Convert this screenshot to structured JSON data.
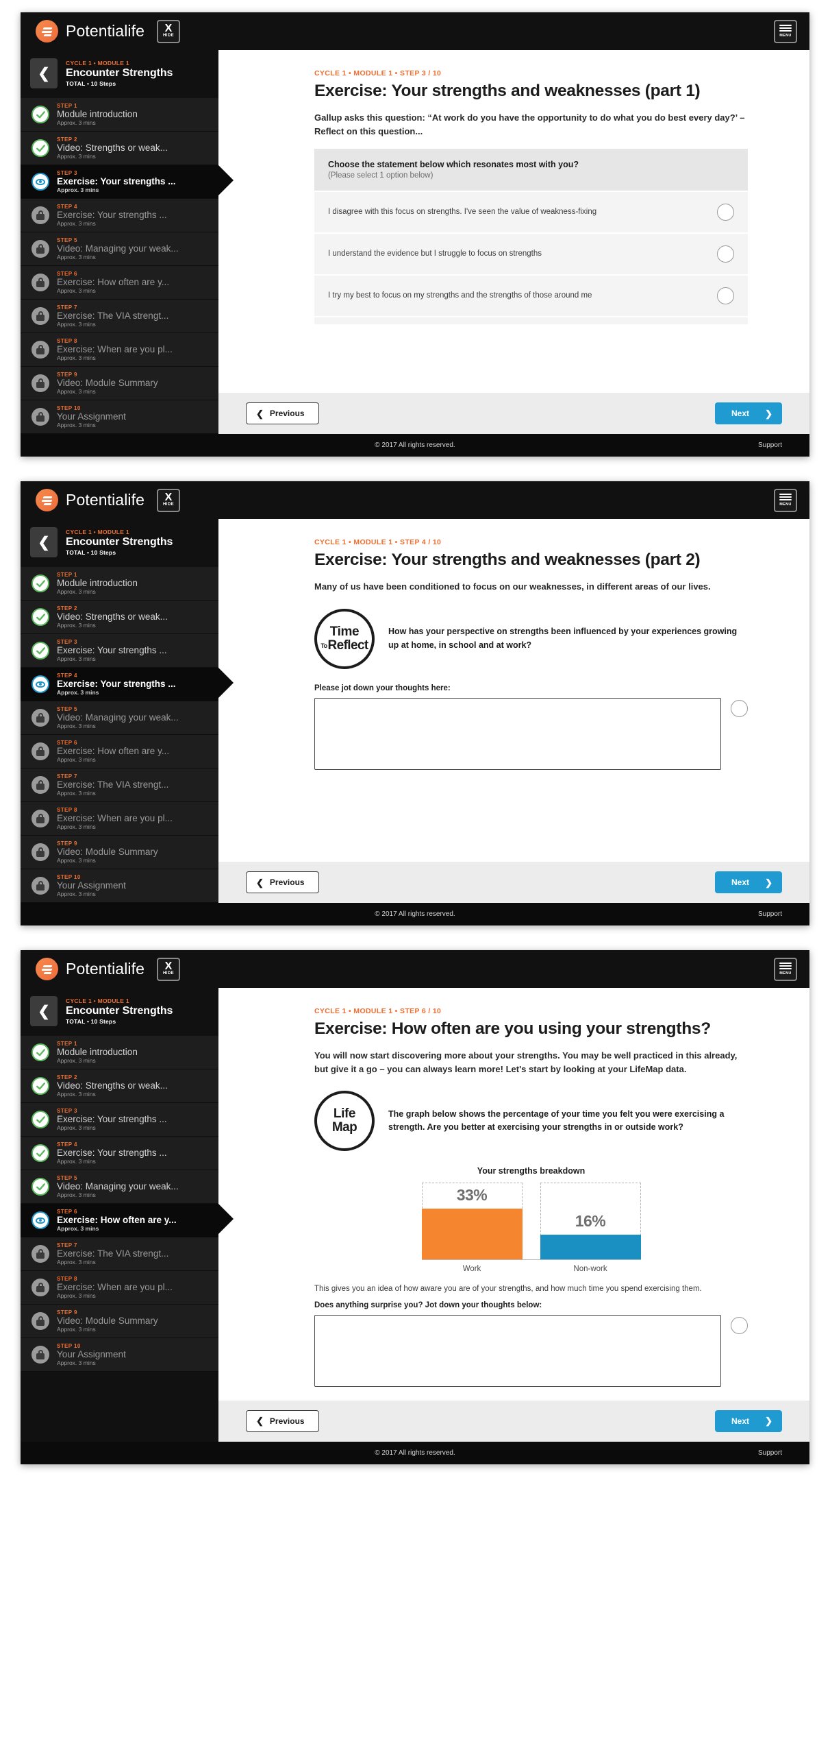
{
  "brand": {
    "name": "Potentialife",
    "logo_icon": "potentialife-logo-icon"
  },
  "topbar": {
    "hide_label": "HIDE",
    "hide_x": "X",
    "menu_label": "MENU"
  },
  "sidebar": {
    "back_icon": "chevron-left-icon",
    "module_crumb": "CYCLE 1 • MODULE 1",
    "module_title": "Encounter Strengths",
    "module_total": "TOTAL • 10 Steps",
    "time_default": "Approx. 3 mins",
    "steps": [
      {
        "no": "STEP 1",
        "name": "Module introduction",
        "time": "Approx. 3 mins",
        "state": "done",
        "icon": "check-circle-icon"
      },
      {
        "no": "STEP 2",
        "name": "Video: Strengths or weak...",
        "time": "Approx. 3 mins",
        "state": "done",
        "icon": "check-circle-icon"
      },
      {
        "no": "STEP 3",
        "name": "Exercise: Your strengths ...",
        "time": "Approx. 3 mins",
        "state": "done",
        "icon": "check-circle-icon"
      },
      {
        "no": "STEP 4",
        "name": "Exercise: Your strengths ...",
        "time": "Approx. 3 mins",
        "state": "done",
        "icon": "check-circle-icon"
      },
      {
        "no": "STEP 5",
        "name": "Video: Managing your weak...",
        "time": "Approx. 3 mins",
        "state": "done",
        "icon": "check-circle-icon"
      },
      {
        "no": "STEP 6",
        "name": "Exercise: How often are y...",
        "time": "Approx. 3 mins",
        "state": "locked",
        "icon": "lock-icon"
      },
      {
        "no": "STEP 7",
        "name": "Exercise: The VIA strengt...",
        "time": "Approx. 3 mins",
        "state": "locked",
        "icon": "lock-icon"
      },
      {
        "no": "STEP 8",
        "name": "Exercise: When are you pl...",
        "time": "Approx. 3 mins",
        "state": "locked",
        "icon": "lock-icon"
      },
      {
        "no": "STEP 9",
        "name": "Video: Module Summary",
        "time": "Approx. 3 mins",
        "state": "locked",
        "icon": "lock-icon"
      },
      {
        "no": "STEP 10",
        "name": "Your Assignment",
        "time": "Approx. 3 mins",
        "state": "locked",
        "icon": "lock-icon"
      }
    ]
  },
  "nav": {
    "previous": "Previous",
    "next": "Next",
    "prev_icon": "chevron-left-icon",
    "next_icon": "chevron-right-icon"
  },
  "footer": {
    "copyright": "© 2017 All rights reserved.",
    "support": "Support"
  },
  "panel1": {
    "crumb": "CYCLE 1 • MODULE 1 • STEP 3 / 10",
    "title": "Exercise: Your strengths and weaknesses (part 1)",
    "lead": "Gallup asks this question: “At work do you have the opportunity to do what you do best every day?’ – Reflect on this question...",
    "question": "Choose the statement below which resonates most with you?",
    "question_sub": "(Please select 1 option below)",
    "options": [
      "I disagree with this focus on strengths. I've seen the value of weakness-fixing",
      "I understand the evidence but I struggle to focus on strengths",
      "I try my best to focus on my strengths and the strengths of those around me"
    ],
    "active_step_index": 2
  },
  "panel2": {
    "crumb": "CYCLE 1 • MODULE 1 • STEP 4 / 10",
    "title": "Exercise: Your strengths and weaknesses (part 2)",
    "lead": "Many of us have been conditioned to focus on our weaknesses, in different areas of our lives.",
    "badge": {
      "line1": "Time",
      "sup": "To",
      "line2": "Reflect"
    },
    "badge_question": "How has your perspective on strengths been influenced by your experiences growing up at home, in school and at work?",
    "jot_label": "Please jot down your thoughts here:",
    "textarea_value": "",
    "active_step_index": 3
  },
  "panel3": {
    "crumb": "CYCLE 1 • MODULE 1 • STEP 6 / 10",
    "title": "Exercise: How often are you using your strengths?",
    "lead": "You will now start discovering more about your strengths. You may be well practiced in this already, but give it a go – you can always learn more! Let's start by looking at your LifeMap data.",
    "badge": {
      "line1": "Life",
      "line2": "Map"
    },
    "badge_question": "The graph below shows the percentage of your time you felt you were exercising a strength. Are you better at exercising your strengths in or outside work?",
    "after_chart": "This gives you an idea of how aware you are of your strengths, and how much time you spend exercising them.",
    "jot_label": "Does anything surprise you? Jot down your thoughts below:",
    "textarea_value": "",
    "active_step_index": 5
  },
  "chart_data": {
    "type": "bar",
    "title": "Your strengths breakdown",
    "categories": [
      "Work",
      "Non-work"
    ],
    "values": [
      33,
      16
    ],
    "value_labels": [
      "33%",
      "16%"
    ],
    "colors": [
      "#f6852f",
      "#1a8fc1"
    ],
    "ylim": [
      0,
      50
    ],
    "xlabel": "",
    "ylabel": "",
    "grid": false,
    "legend": "none"
  },
  "colors": {
    "accent_orange": "#ef6c2e",
    "accent_blue": "#1f9bd1",
    "bar_work": "#f6852f",
    "bar_nonwork": "#1a8fc1",
    "done_green": "#5cb85c",
    "dark": "#111111"
  }
}
